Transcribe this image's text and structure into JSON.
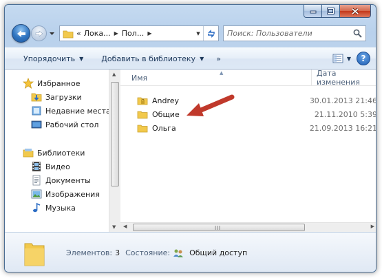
{
  "address": {
    "crumb_sep": "«",
    "crumbs": [
      "Лока...",
      "Пол..."
    ]
  },
  "search": {
    "placeholder": "Поиск: Пользователи"
  },
  "toolbar": {
    "organize_label": "Упорядочить",
    "library_label": "Добавить в библиотеку",
    "more_label": "»"
  },
  "nav": {
    "favorites_head": "Избранное",
    "favorites": [
      "Загрузки",
      "Недавние места",
      "Рабочий стол"
    ],
    "libraries_head": "Библиотеки",
    "libraries": [
      "Видео",
      "Документы",
      "Изображения",
      "Музыка"
    ]
  },
  "columns": {
    "name": "Имя",
    "date": "Дата изменения"
  },
  "files": [
    {
      "name": "Andrey",
      "date": "30.01.2013 21:46"
    },
    {
      "name": "Общие",
      "date": "21.11.2010 5:39"
    },
    {
      "name": "Ольга",
      "date": "21.09.2013 16:21"
    }
  ],
  "status": {
    "items_label": "Элементов:",
    "items_count": "3",
    "state_label": "Состояние:",
    "state_value": "Общий доступ"
  },
  "colors": {
    "annotation_arrow": "#c0392b",
    "folder": "#f2c94c"
  }
}
